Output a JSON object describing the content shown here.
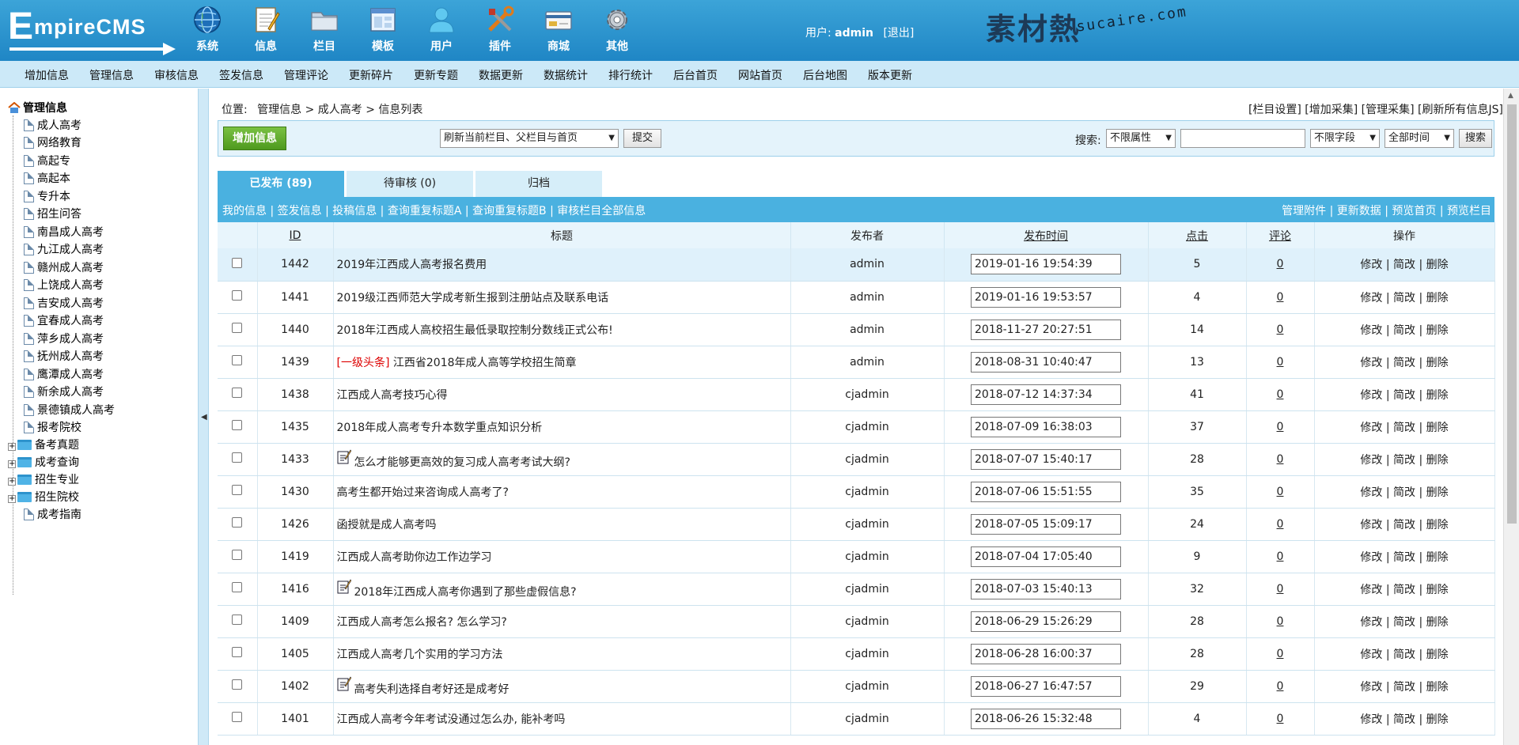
{
  "header": {
    "logo": "EmpireCMS",
    "nav": [
      {
        "label": "系统",
        "icon": "globe-icon"
      },
      {
        "label": "信息",
        "icon": "notepad-icon"
      },
      {
        "label": "栏目",
        "icon": "folder-icon"
      },
      {
        "label": "模板",
        "icon": "window-icon"
      },
      {
        "label": "用户",
        "icon": "user-icon"
      },
      {
        "label": "插件",
        "icon": "tools-icon"
      },
      {
        "label": "商城",
        "icon": "card-icon"
      },
      {
        "label": "其他",
        "icon": "gear-icon"
      }
    ],
    "user_label": "用户:",
    "user_name": "admin",
    "logout": "[退出]",
    "watermark_cn": "素材熱",
    "watermark_en": "sucaire.com"
  },
  "subnav": [
    "增加信息",
    "管理信息",
    "审核信息",
    "签发信息",
    "管理评论",
    "更新碎片",
    "更新专题",
    "数据更新",
    "数据统计",
    "排行统计",
    "后台首页",
    "网站首页",
    "后台地图",
    "版本更新"
  ],
  "tree": {
    "root": "管理信息",
    "items": [
      "成人高考",
      "网络教育",
      "高起专",
      "高起本",
      "专升本",
      "招生问答",
      "南昌成人高考",
      "九江成人高考",
      "赣州成人高考",
      "上饶成人高考",
      "吉安成人高考",
      "宜春成人高考",
      "萍乡成人高考",
      "抚州成人高考",
      "鹰潭成人高考",
      "新余成人高考",
      "景德镇成人高考",
      "报考院校"
    ],
    "folders": [
      "备考真题",
      "成考查询",
      "招生专业",
      "招生院校"
    ],
    "last": "成考指南"
  },
  "breadcrumb": {
    "label": "位置:",
    "path": "管理信息 > 成人高考 > 信息列表"
  },
  "top_links": "[栏目设置] [增加采集] [管理采集] [刷新所有信息JS]",
  "toolbar": {
    "add_label": "增加信息",
    "refresh_select": "刷新当前栏目、父栏目与首页",
    "submit": "提交",
    "search_label": "搜索:",
    "attr_select": "不限属性",
    "search_value": "",
    "field_select": "不限字段",
    "time_select": "全部时间",
    "search_btn": "搜索"
  },
  "tabs": [
    {
      "label": "已发布 (89)"
    },
    {
      "label": "待审核 (0)"
    },
    {
      "label": "归档"
    }
  ],
  "infobar": {
    "left": "我的信息 | 签发信息 | 投稿信息 | 查询重复标题A | 查询重复标题B | 审核栏目全部信息",
    "right": "管理附件 | 更新数据 | 预览首页 | 预览栏目"
  },
  "table": {
    "headers": [
      "",
      "ID",
      "标题",
      "发布者",
      "发布时间",
      "点击",
      "评论",
      "操作"
    ],
    "rows": [
      {
        "id": "1442",
        "title": "2019年江西成人高考报名费用",
        "tag": "",
        "icon": false,
        "author": "admin",
        "time": "2019-01-16 19:54:39",
        "clicks": "5",
        "comments": "0",
        "ops": "修改 | 简改 | 删除"
      },
      {
        "id": "1441",
        "title": "2019级江西师范大学成考新生报到注册站点及联系电话",
        "tag": "",
        "icon": false,
        "author": "admin",
        "time": "2019-01-16 19:53:57",
        "clicks": "4",
        "comments": "0",
        "ops": "修改 | 简改 | 删除"
      },
      {
        "id": "1440",
        "title": "2018年江西成人高校招生最低录取控制分数线正式公布!",
        "tag": "",
        "icon": false,
        "author": "admin",
        "time": "2018-11-27 20:27:51",
        "clicks": "14",
        "comments": "0",
        "ops": "修改 | 简改 | 删除"
      },
      {
        "id": "1439",
        "title": "江西省2018年成人高等学校招生简章",
        "tag": "[一级头条]",
        "icon": false,
        "author": "admin",
        "time": "2018-08-31 10:40:47",
        "clicks": "13",
        "comments": "0",
        "ops": "修改 | 简改 | 删除"
      },
      {
        "id": "1438",
        "title": "江西成人高考技巧心得",
        "tag": "",
        "icon": false,
        "author": "cjadmin",
        "time": "2018-07-12 14:37:34",
        "clicks": "41",
        "comments": "0",
        "ops": "修改 | 简改 | 删除"
      },
      {
        "id": "1435",
        "title": "2018年成人高考专升本数学重点知识分析",
        "tag": "",
        "icon": false,
        "author": "cjadmin",
        "time": "2018-07-09 16:38:03",
        "clicks": "37",
        "comments": "0",
        "ops": "修改 | 简改 | 删除"
      },
      {
        "id": "1433",
        "title": "怎么才能够更高效的复习成人高考考试大纲?",
        "tag": "",
        "icon": true,
        "author": "cjadmin",
        "time": "2018-07-07 15:40:17",
        "clicks": "28",
        "comments": "0",
        "ops": "修改 | 简改 | 删除"
      },
      {
        "id": "1430",
        "title": "高考生都开始过来咨询成人高考了?",
        "tag": "",
        "icon": false,
        "author": "cjadmin",
        "time": "2018-07-06 15:51:55",
        "clicks": "35",
        "comments": "0",
        "ops": "修改 | 简改 | 删除"
      },
      {
        "id": "1426",
        "title": "函授就是成人高考吗",
        "tag": "",
        "icon": false,
        "author": "cjadmin",
        "time": "2018-07-05 15:09:17",
        "clicks": "24",
        "comments": "0",
        "ops": "修改 | 简改 | 删除"
      },
      {
        "id": "1419",
        "title": "江西成人高考助你边工作边学习",
        "tag": "",
        "icon": false,
        "author": "cjadmin",
        "time": "2018-07-04 17:05:40",
        "clicks": "9",
        "comments": "0",
        "ops": "修改 | 简改 | 删除"
      },
      {
        "id": "1416",
        "title": "2018年江西成人高考你遇到了那些虚假信息?",
        "tag": "",
        "icon": true,
        "author": "cjadmin",
        "time": "2018-07-03 15:40:13",
        "clicks": "32",
        "comments": "0",
        "ops": "修改 | 简改 | 删除"
      },
      {
        "id": "1409",
        "title": "江西成人高考怎么报名? 怎么学习?",
        "tag": "",
        "icon": false,
        "author": "cjadmin",
        "time": "2018-06-29 15:26:29",
        "clicks": "28",
        "comments": "0",
        "ops": "修改 | 简改 | 删除"
      },
      {
        "id": "1405",
        "title": "江西成人高考几个实用的学习方法",
        "tag": "",
        "icon": false,
        "author": "cjadmin",
        "time": "2018-06-28 16:00:37",
        "clicks": "28",
        "comments": "0",
        "ops": "修改 | 简改 | 删除"
      },
      {
        "id": "1402",
        "title": "高考失利选择自考好还是成考好",
        "tag": "",
        "icon": true,
        "author": "cjadmin",
        "time": "2018-06-27 16:47:57",
        "clicks": "29",
        "comments": "0",
        "ops": "修改 | 简改 | 删除"
      },
      {
        "id": "1401",
        "title": "江西成人高考今年考试没通过怎么办, 能补考吗",
        "tag": "",
        "icon": false,
        "author": "cjadmin",
        "time": "2018-06-26 15:32:48",
        "clicks": "4",
        "comments": "0",
        "ops": "修改 | 简改 | 删除"
      }
    ]
  },
  "colors": {
    "header": "#2a93cf",
    "subnav": "#cce9f8",
    "accent": "#4ab1e0",
    "add_button": "#5fab2c",
    "highlight_row": "#dff1fb",
    "tag": "#dd0000"
  }
}
